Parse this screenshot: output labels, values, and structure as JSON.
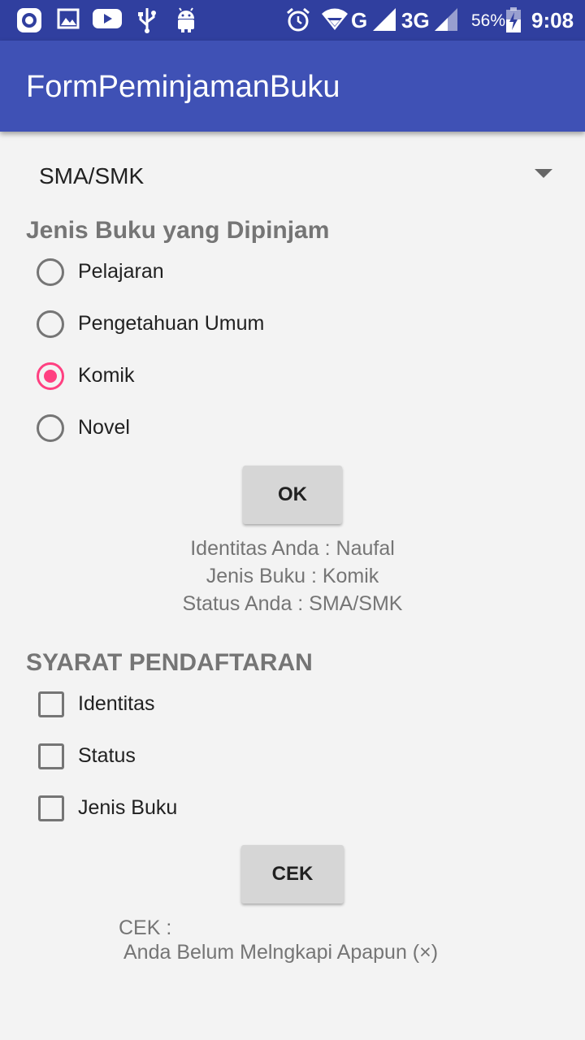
{
  "status_bar": {
    "network_g": "G",
    "network_3g": "3G",
    "battery": "56%",
    "time": "9:08",
    "icons": [
      "camera-app-icon",
      "image-icon",
      "youtube-icon",
      "usb-icon",
      "android-icon",
      "alarm-icon",
      "wifi-icon",
      "signal-icon",
      "battery-icon"
    ]
  },
  "app_bar": {
    "title": "FormPeminjamanBuku"
  },
  "spinner": {
    "selected": "SMA/SMK"
  },
  "book_type": {
    "title": "Jenis Buku yang Dipinjam",
    "options": [
      {
        "label": "Pelajaran",
        "checked": false
      },
      {
        "label": "Pengetahuan Umum",
        "checked": false
      },
      {
        "label": "Komik",
        "checked": true
      },
      {
        "label": "Novel",
        "checked": false
      }
    ]
  },
  "ok_button": {
    "label": "OK"
  },
  "result": {
    "identity": "Identitas Anda : Naufal",
    "book": "Jenis Buku : Komik",
    "status": "Status Anda : SMA/SMK"
  },
  "requirements": {
    "title": "SYARAT PENDAFTARAN",
    "items": [
      {
        "label": "Identitas",
        "checked": false
      },
      {
        "label": "Status",
        "checked": false
      },
      {
        "label": "Jenis Buku",
        "checked": false
      }
    ]
  },
  "cek_button": {
    "label": "CEK"
  },
  "cek_result": {
    "heading": "CEK :",
    "message": "Anda Belum Melngkapi Apapun  (×)"
  },
  "colors": {
    "status_bar": "#303F9F",
    "app_bar": "#3F51B5",
    "accent": "#FF4081",
    "background": "#f3f3f3"
  }
}
